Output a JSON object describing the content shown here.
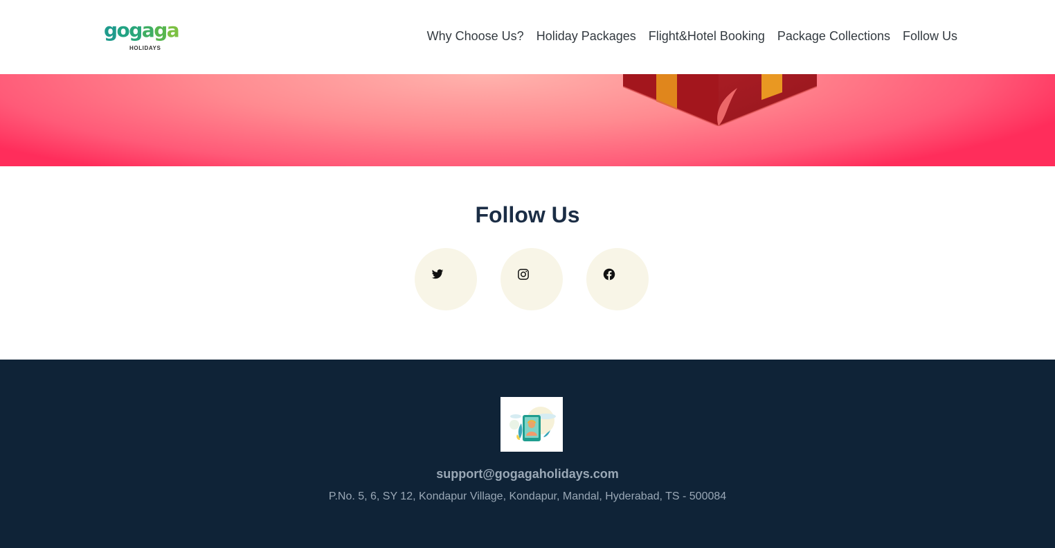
{
  "header": {
    "logo": {
      "brand": "gogaga",
      "subtitle": "HOLIDAYS",
      "icon": "gogaga-holidays-logo"
    },
    "nav": [
      {
        "label": "Why Choose Us?"
      },
      {
        "label": "Holiday Packages"
      },
      {
        "label": "Flight&Hotel Booking"
      },
      {
        "label": "Package Collections"
      },
      {
        "label": "Follow Us"
      }
    ]
  },
  "hero": {
    "image": "gift-box-illustration"
  },
  "follow": {
    "title": "Follow Us",
    "socials": [
      {
        "icon": "twitter-icon"
      },
      {
        "icon": "instagram-icon"
      },
      {
        "icon": "facebook-icon"
      }
    ]
  },
  "footer": {
    "image": "support-agent-illustration",
    "email": "support@gogagaholidays.com",
    "address": "P.No. 5, 6, SY 12, Kondapur Village, Kondapur, Mandal, Hyderabad, TS - 500084"
  },
  "colors": {
    "nav_text": "#333a40",
    "title": "#1b2d45",
    "social_bg": "#f8f5e7",
    "footer_bg": "#0f2337",
    "footer_text": "#9aa8b6",
    "hero_pink": "#ff2d5b"
  }
}
